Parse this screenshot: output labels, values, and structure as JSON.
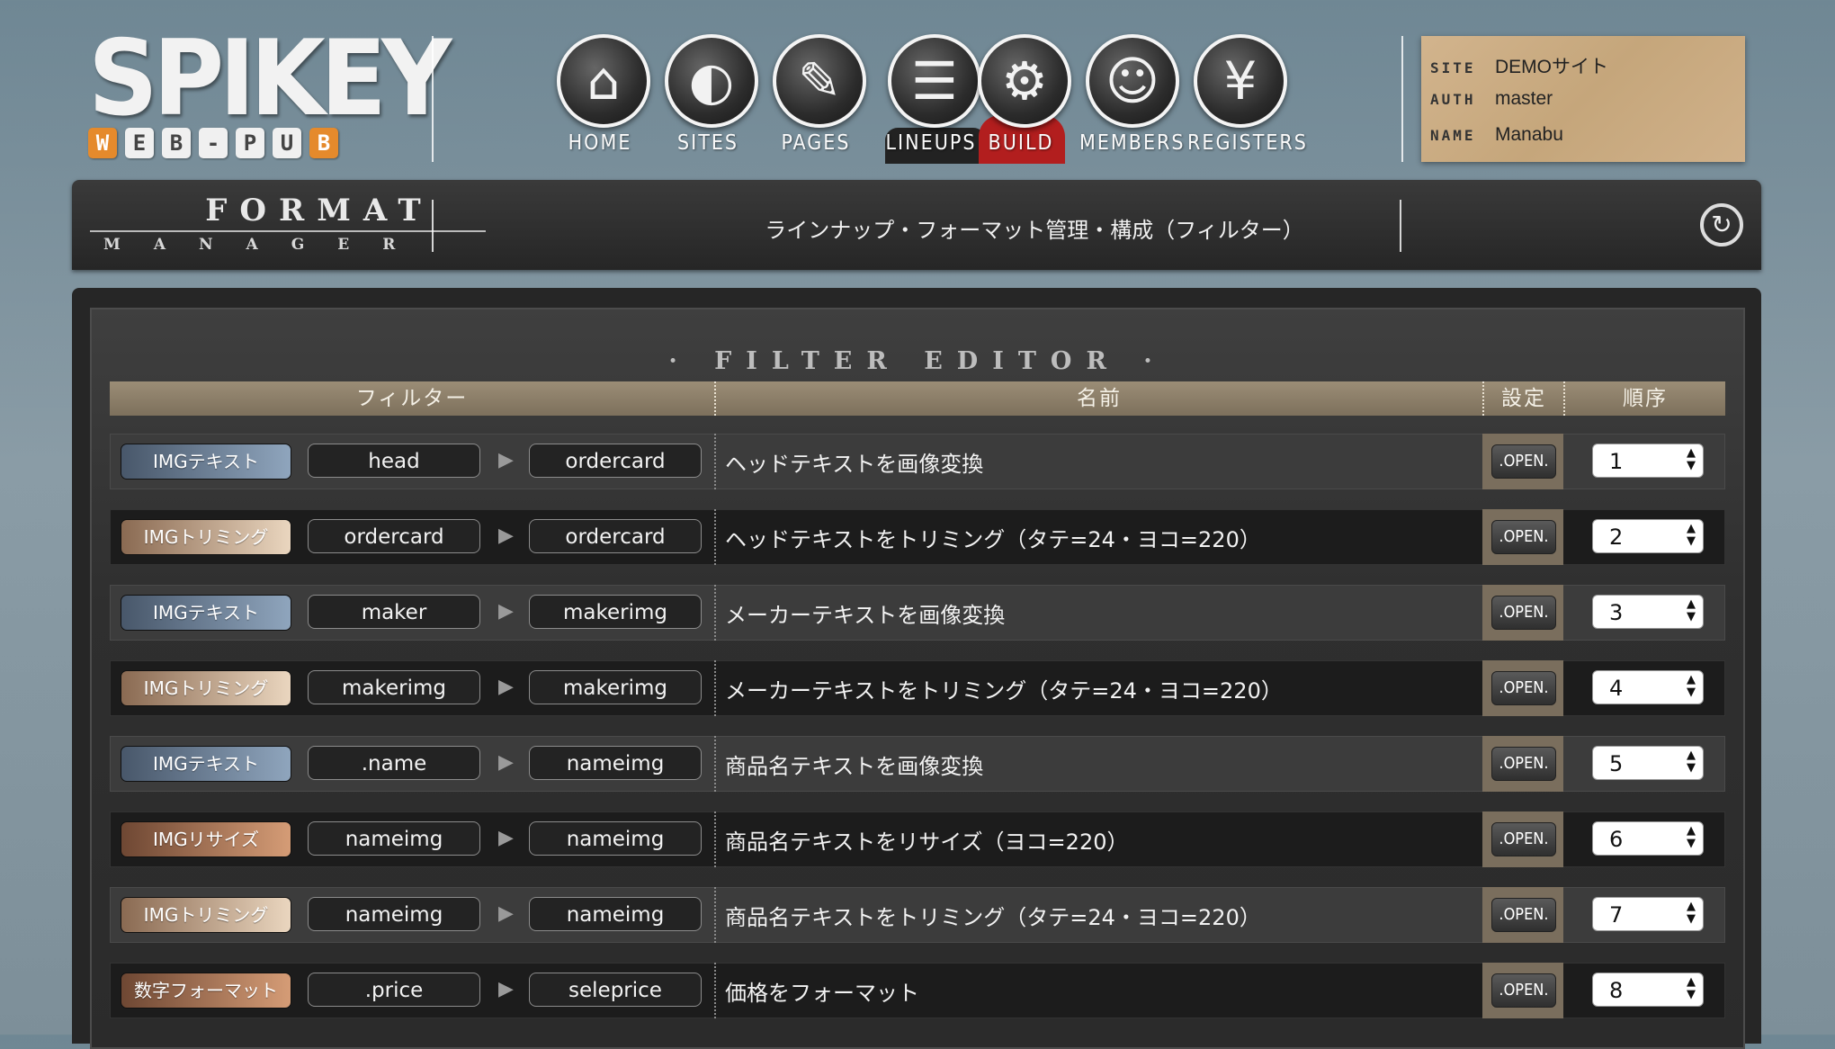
{
  "logo": {
    "title": "SPIKEY",
    "letters": [
      "W",
      "E",
      "B",
      "-",
      "P",
      "U",
      "B"
    ]
  },
  "nav": [
    {
      "label": "HOME",
      "icon": "⌂"
    },
    {
      "label": "SITES",
      "icon": "◐"
    },
    {
      "label": "PAGES",
      "icon": "✎"
    },
    {
      "label": "LINEUPS",
      "icon": "☰"
    },
    {
      "label": "BUILD",
      "icon": "⚙"
    },
    {
      "label": "MEMBERS",
      "icon": "☺"
    },
    {
      "label": "REGISTERS",
      "icon": "¥"
    }
  ],
  "info": {
    "site_key": "SITE",
    "site_val": "DEMOサイト",
    "auth_key": "AUTH",
    "auth_val": "master",
    "name_key": "NAME",
    "name_val": "Manabu"
  },
  "titlebar": {
    "format": "FORMAT",
    "manager": "MANAGER",
    "page_title": "ラインナップ・フォーマット管理・構成（フィルター）",
    "refresh_icon": "↻"
  },
  "editor": {
    "title": "· FILTER EDITOR ·",
    "headers": {
      "filter": "フィルター",
      "name": "名前",
      "setting": "設定",
      "order": "順序"
    },
    "rows": [
      {
        "type": "IMGテキスト",
        "color": "blue",
        "src": "head",
        "dst": "ordercard",
        "name": "ヘッドテキストを画像変換",
        "open": ".OPEN.",
        "order": "1"
      },
      {
        "type": "IMGトリミング",
        "color": "beige",
        "src": "ordercard",
        "dst": "ordercard",
        "name": "ヘッドテキストをトリミング（タテ=24・ヨコ=220）",
        "open": ".OPEN.",
        "order": "2"
      },
      {
        "type": "IMGテキスト",
        "color": "blue",
        "src": "maker",
        "dst": "makerimg",
        "name": "メーカーテキストを画像変換",
        "open": ".OPEN.",
        "order": "3"
      },
      {
        "type": "IMGトリミング",
        "color": "beige",
        "src": "makerimg",
        "dst": "makerimg",
        "name": "メーカーテキストをトリミング（タテ=24・ヨコ=220）",
        "open": ".OPEN.",
        "order": "4"
      },
      {
        "type": "IMGテキスト",
        "color": "blue",
        "src": ".name",
        "dst": "nameimg",
        "name": "商品名テキストを画像変換",
        "open": ".OPEN.",
        "order": "5"
      },
      {
        "type": "IMGリサイズ",
        "color": "brown",
        "src": "nameimg",
        "dst": "nameimg",
        "name": "商品名テキストをリサイズ（ヨコ=220）",
        "open": ".OPEN.",
        "order": "6"
      },
      {
        "type": "IMGトリミング",
        "color": "beige",
        "src": "nameimg",
        "dst": "nameimg",
        "name": "商品名テキストをトリミング（タテ=24・ヨコ=220）",
        "open": ".OPEN.",
        "order": "7"
      },
      {
        "type": "数字フォーマット",
        "color": "brown",
        "src": ".price",
        "dst": "seleprice",
        "name": "価格をフォーマット",
        "open": ".OPEN.",
        "order": "8"
      }
    ]
  }
}
